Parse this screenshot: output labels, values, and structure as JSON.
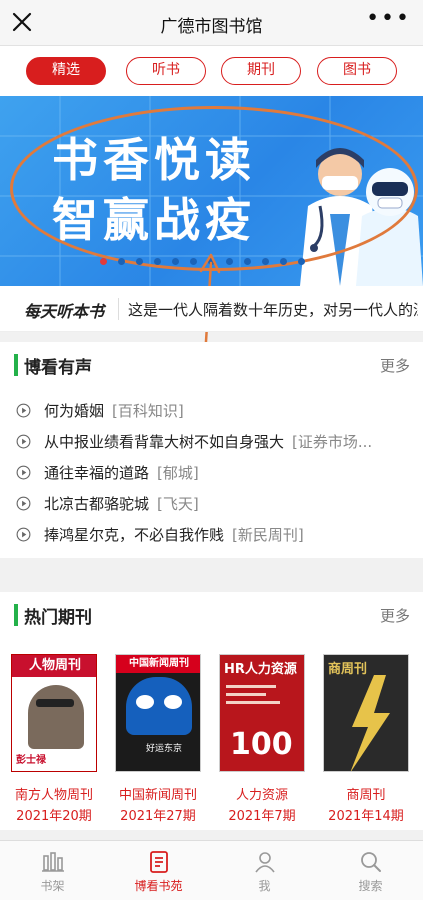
{
  "header": {
    "title": "广德市图书馆",
    "more_glyph": "•••",
    "close_icon": "close-icon"
  },
  "tabs": [
    {
      "label": "精选",
      "active": true
    },
    {
      "label": "听书",
      "active": false
    },
    {
      "label": "期刊",
      "active": false
    },
    {
      "label": "图书",
      "active": false
    }
  ],
  "banner": {
    "line1": "书香悦读",
    "line2": "智赢战疫",
    "slide_count": 12,
    "active_slide": 1
  },
  "notice": {
    "logo_text": "每天听本书",
    "text": "这是一代人隔着数十年历史，对另一代人的深情告白"
  },
  "audio_section": {
    "title": "博看有声",
    "more": "更多",
    "items": [
      {
        "title": "何为婚姻",
        "source": "[百科知识]"
      },
      {
        "title": "从中报业绩看背靠大树不如自身强大",
        "source": "[证券市场..."
      },
      {
        "title": "通往幸福的道路",
        "source": "[郁城]"
      },
      {
        "title": "北凉古都骆驼城",
        "source": "[飞天]"
      },
      {
        "title": "捧鸿星尔克，不必自我作贱",
        "source": "[新民周刊]"
      }
    ]
  },
  "magazine_section": {
    "title": "热门期刊",
    "more": "更多",
    "items": [
      {
        "name": "南方人物周刊",
        "issue": "2021年20期",
        "cover_text": "人物周刊",
        "cover_sub": "彭士禄"
      },
      {
        "name": "中国新闻周刊",
        "issue": "2021年27期",
        "cover_text": "中国新闻周刊",
        "cover_sub": "好运东京"
      },
      {
        "name": "人力资源",
        "issue": "2021年7期",
        "cover_text": "HR人力资源",
        "cover_sub": "100"
      },
      {
        "name": "商周刊",
        "issue": "2021年14期",
        "cover_text": "商周刊",
        "cover_sub": ""
      }
    ]
  },
  "bottom_nav": [
    {
      "label": "书架",
      "icon": "bookshelf-icon",
      "active": false
    },
    {
      "label": "博看书苑",
      "icon": "book-icon",
      "active": true
    },
    {
      "label": "我",
      "icon": "person-icon",
      "active": false
    },
    {
      "label": "搜索",
      "icon": "search-icon",
      "active": false
    }
  ],
  "colors": {
    "accent": "#d81e1e",
    "section_bar": "#24b14a",
    "banner_blue": "#2a86e6",
    "annotation_orange": "#e07a3c"
  }
}
